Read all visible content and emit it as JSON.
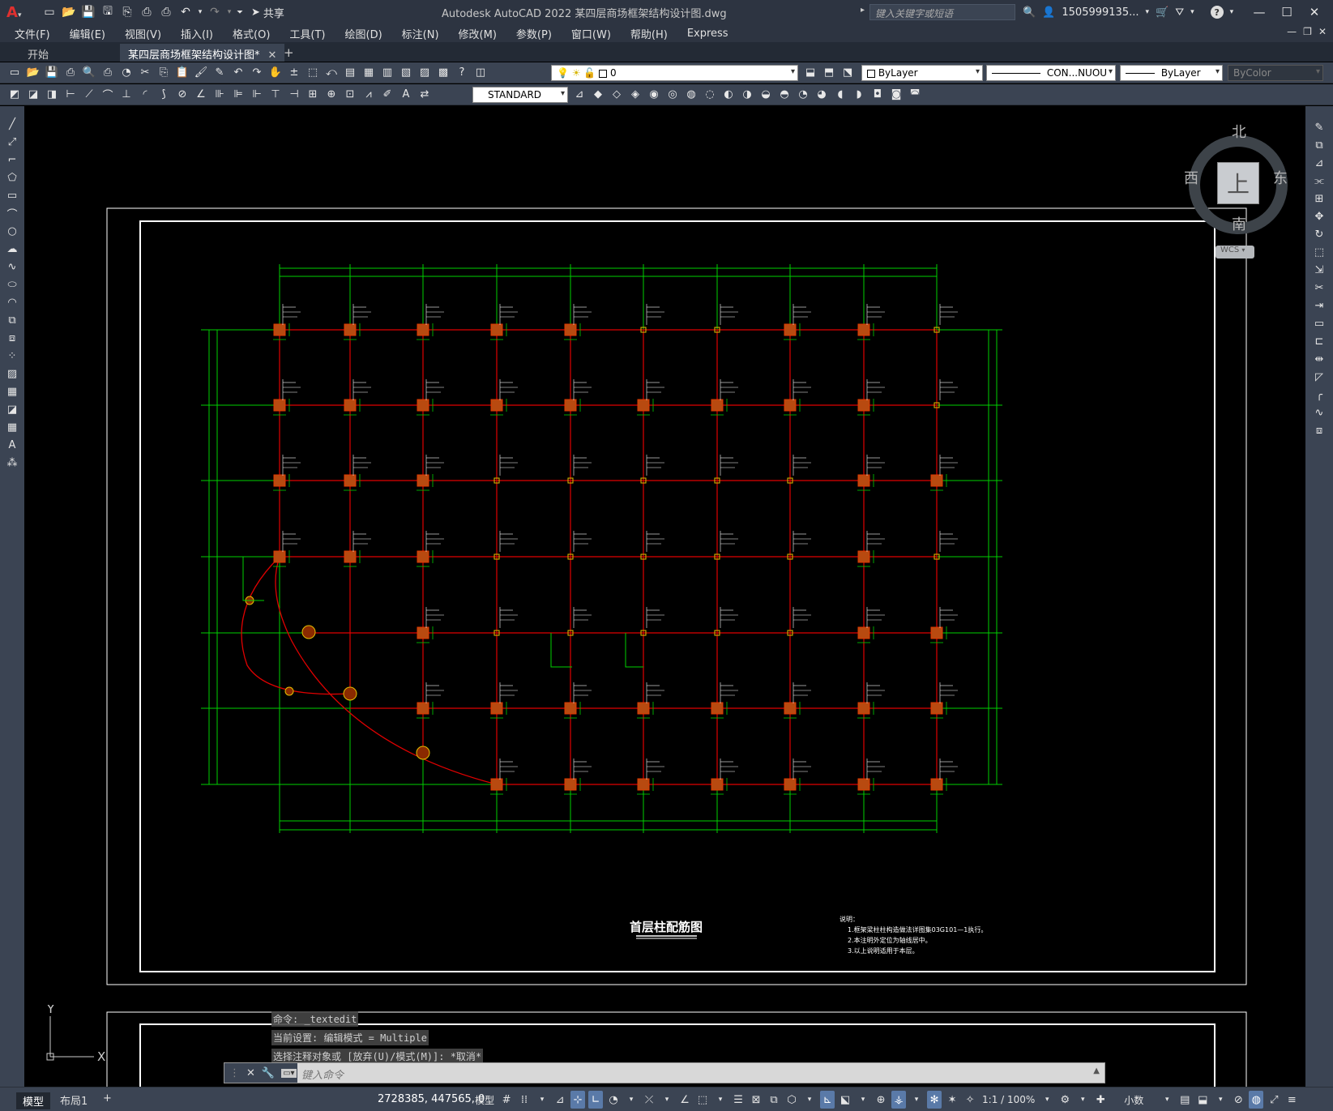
{
  "titlebar": {
    "app_logo": "A",
    "share_label": "共享",
    "title": "Autodesk AutoCAD 2022    某四层商场框架结构设计图.dwg",
    "search_placeholder": "键入关键字或短语",
    "user": "1505999135...",
    "help": "?"
  },
  "menu": [
    "文件(F)",
    "编辑(E)",
    "视图(V)",
    "插入(I)",
    "格式(O)",
    "工具(T)",
    "绘图(D)",
    "标注(N)",
    "修改(M)",
    "参数(P)",
    "窗口(W)",
    "帮助(H)",
    "Express"
  ],
  "tabs": [
    {
      "label": "开始"
    },
    {
      "label": "某四层商场框架结构设计图*"
    }
  ],
  "toolbar": {
    "layer_value": "0",
    "color_value": "ByLayer",
    "linetype_value": "CON...NUOU",
    "lineweight_value": "ByLayer",
    "plotstyle_value": "ByColor",
    "textstyle_value": "STANDARD"
  },
  "viewcube": {
    "north": "北",
    "south": "南",
    "east": "东",
    "west": "西",
    "face": "上",
    "wcs": "WCS"
  },
  "ucs": {
    "y": "Y",
    "x": "X"
  },
  "drawing": {
    "title": "首层柱配筋图",
    "notes_title": "说明：",
    "notes": [
      "1.框架梁柱柱构造做法详图集03G101—1执行。",
      "2.本注明外定位为轴线居中。",
      "3.以上说明适用于本层。"
    ]
  },
  "command": {
    "history": [
      "命令: _textedit",
      "当前设置: 编辑模式 = Multiple",
      "选择注释对象或 [放弃(U)/模式(M)]: *取消*"
    ],
    "placeholder": "键入命令"
  },
  "status": {
    "tab_model": "模型",
    "tab_layout": "布局1",
    "coords": "2728385, 447565, 0",
    "model_label": "模型",
    "scale": "1:1 / 100%",
    "units": "小数"
  }
}
